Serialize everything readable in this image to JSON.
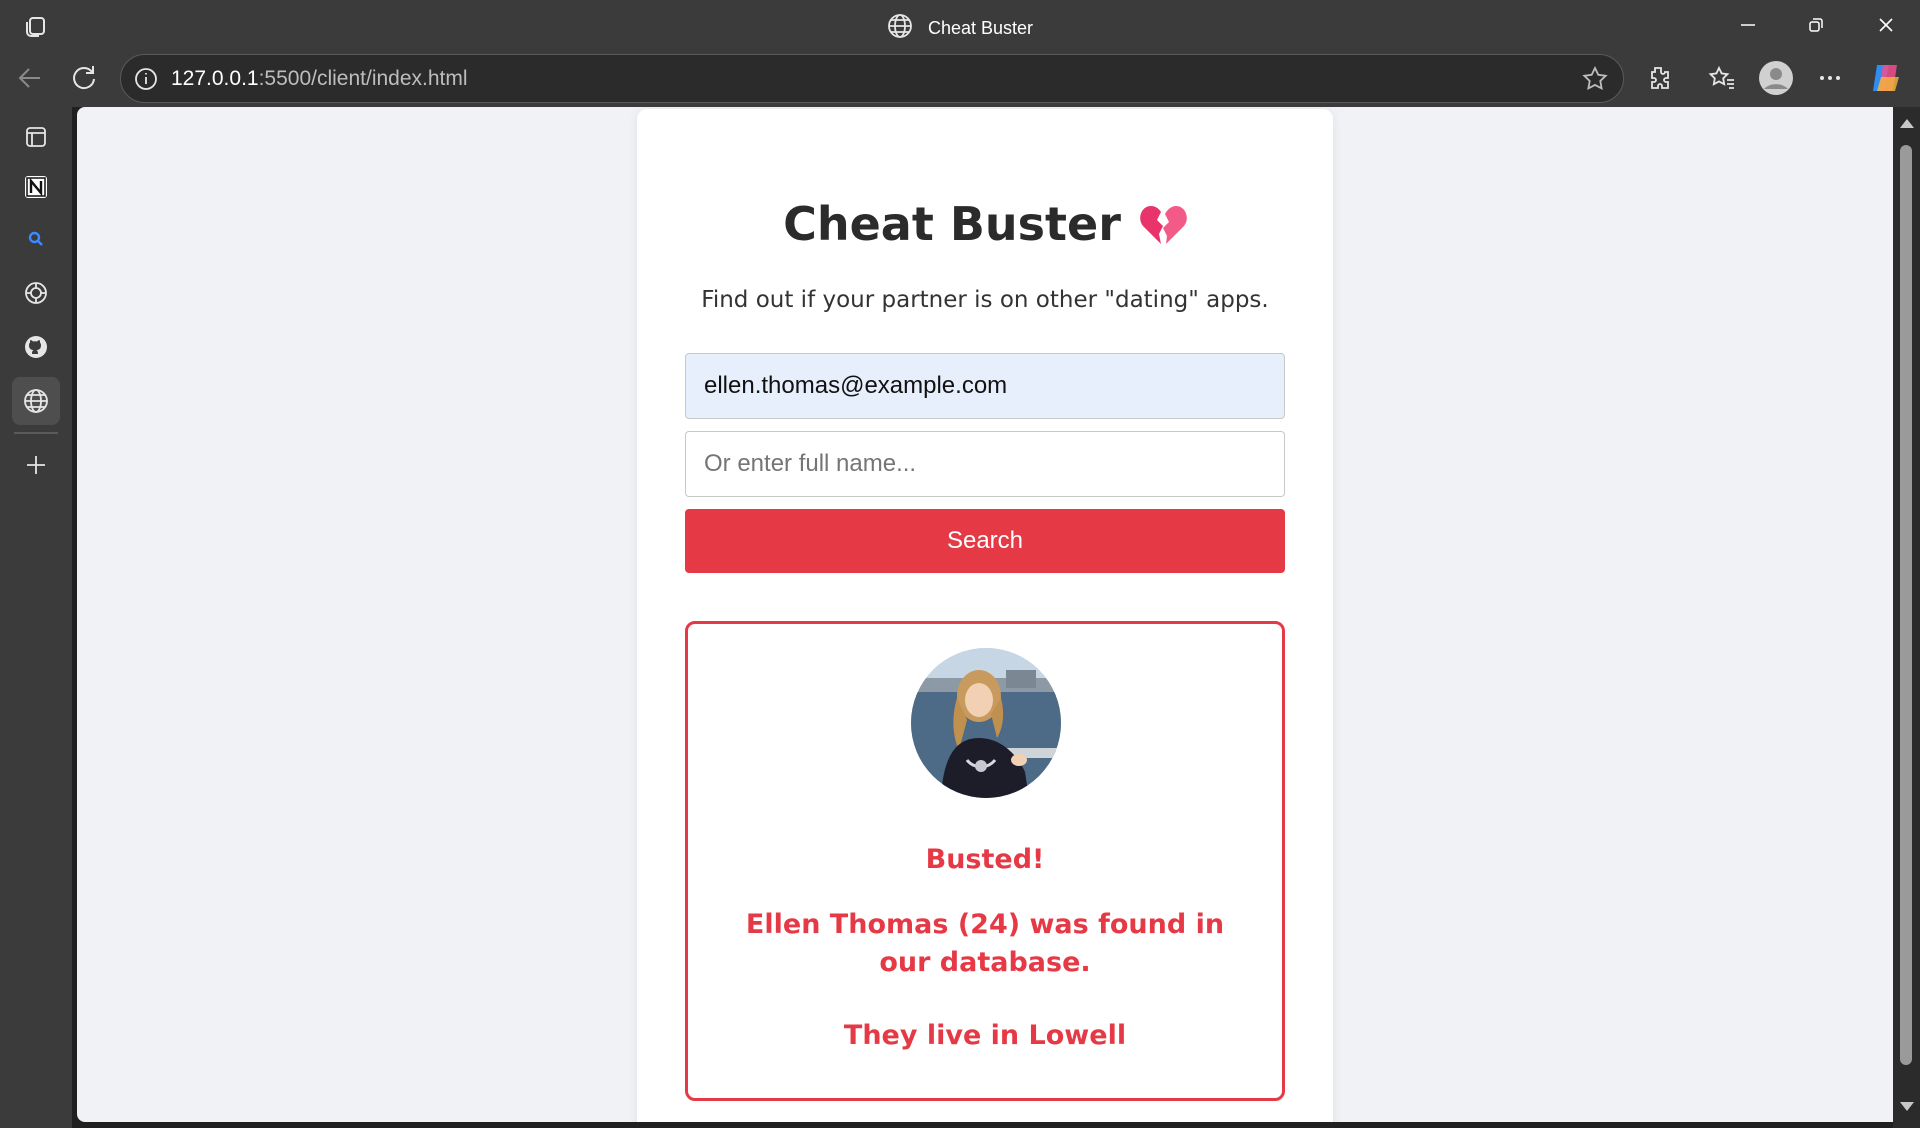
{
  "browser": {
    "tab_title": "Cheat Buster",
    "url_host": "127.0.0.1",
    "url_rest": ":5500/client/index.html"
  },
  "sidebar": {
    "items": [
      "layout-icon",
      "notion-icon",
      "search-icon",
      "openai-icon",
      "github-icon",
      "globe-icon",
      "add-icon"
    ]
  },
  "page": {
    "title": "Cheat Buster",
    "subtitle": "Find out if your partner is on other \"dating\" apps.",
    "email_value": "ellen.thomas@example.com",
    "name_placeholder": "Or enter full name...",
    "search_label": "Search",
    "result": {
      "busted": "Busted!",
      "name": "Ellen Thomas",
      "found_rest": " (24) was found in our database.",
      "lives": "They live in Lowell"
    }
  },
  "colors": {
    "accent": "#e63946",
    "page_bg": "#f0f2f6",
    "chrome": "#3b3b3b"
  }
}
